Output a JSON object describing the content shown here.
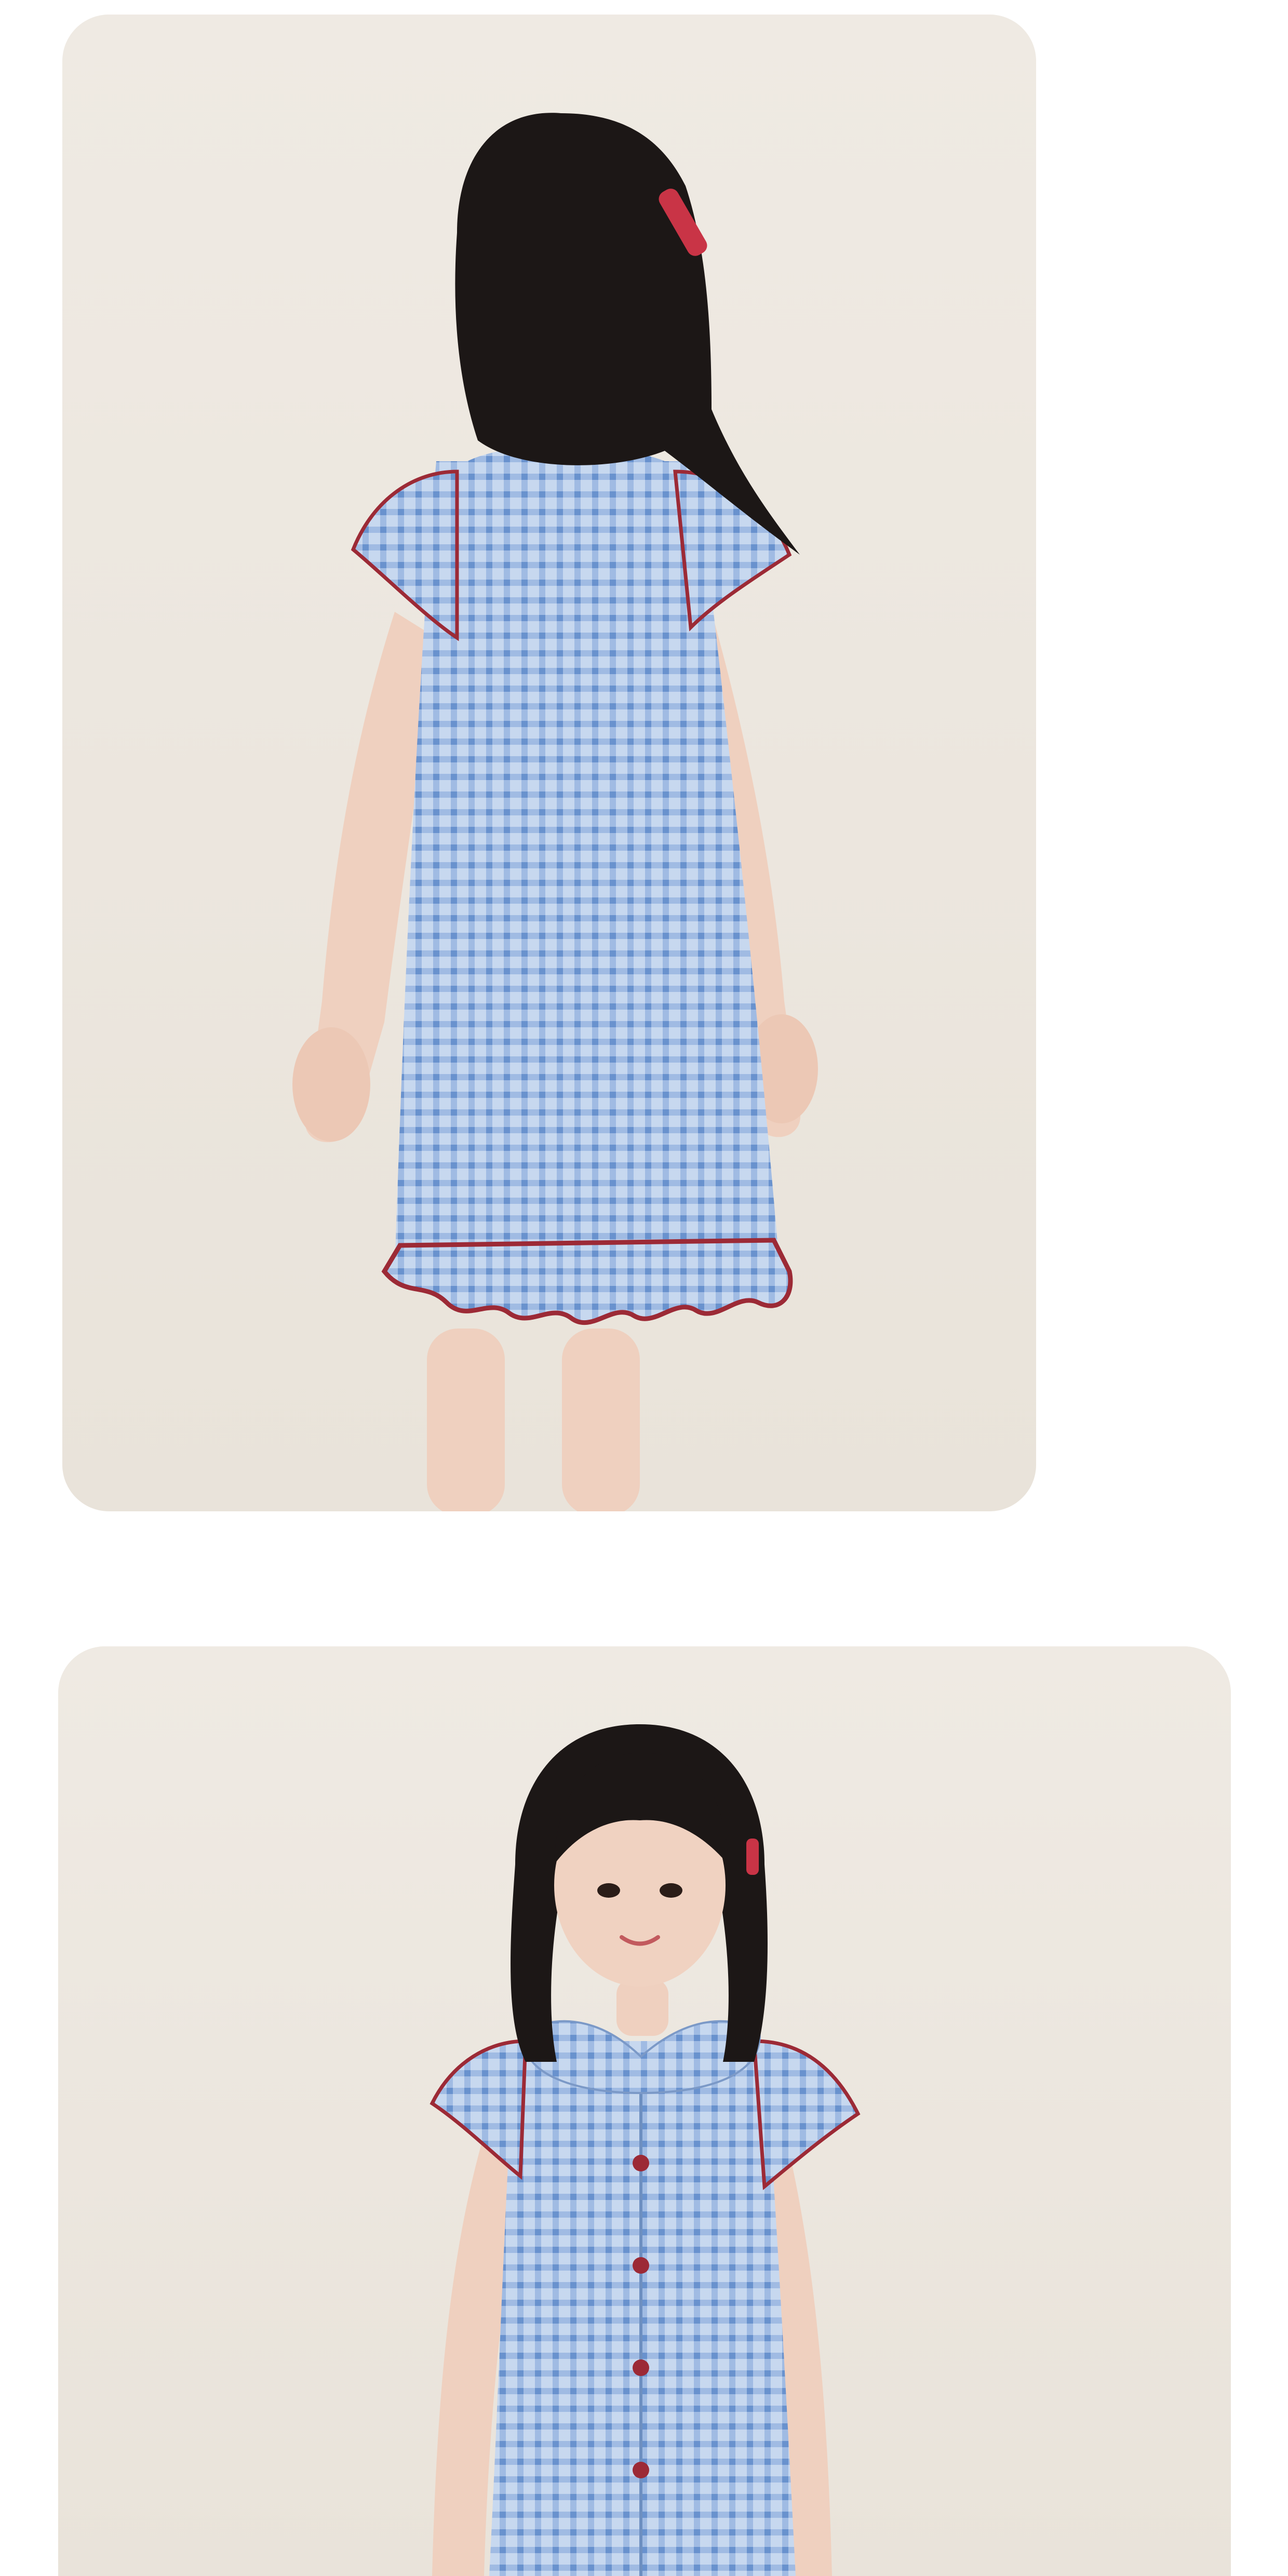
{
  "page": {
    "background_color": "#ffffff"
  },
  "photos": [
    {
      "subject": "girl-back-view",
      "background_color": "#ece7df"
    },
    {
      "subject": "girl-front-view",
      "background_color": "#ece7df"
    }
  ],
  "colors": {
    "dress_blue": "#8fb2dc",
    "gingham_line": "#5f8fd0",
    "trim_red": "#9c2a36",
    "hair": "#1c1716",
    "skin": "#f0d2c1",
    "hair_clip": "#c93446"
  }
}
